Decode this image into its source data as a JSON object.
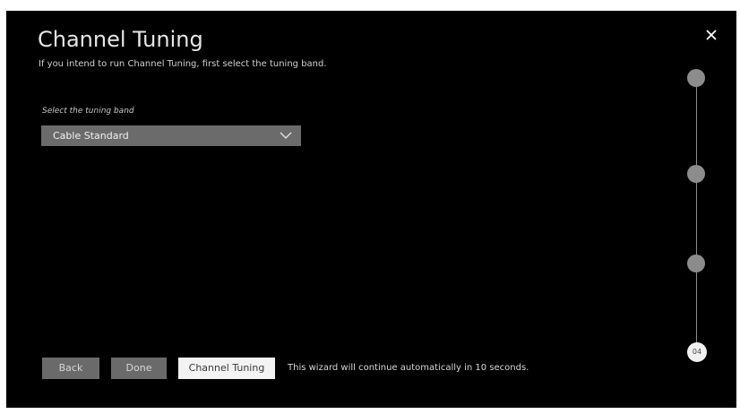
{
  "header": {
    "title": "Channel Tuning",
    "subtitle": "If you intend to run Channel Tuning, first select the tuning band."
  },
  "close_icon": "close-icon",
  "tuning_band": {
    "label": "Select the tuning band",
    "selected": "Cable Standard"
  },
  "steps": {
    "current": "04",
    "total": 4
  },
  "footer": {
    "back_label": "Back",
    "done_label": "Done",
    "tuning_label": "Channel Tuning",
    "auto_message": "This wizard will continue automatically in 10 seconds."
  },
  "colors": {
    "background": "#000000",
    "button": "#6a6a6a",
    "focused_button": "#f3f3f3",
    "step_dot": "#8c8c8c"
  }
}
